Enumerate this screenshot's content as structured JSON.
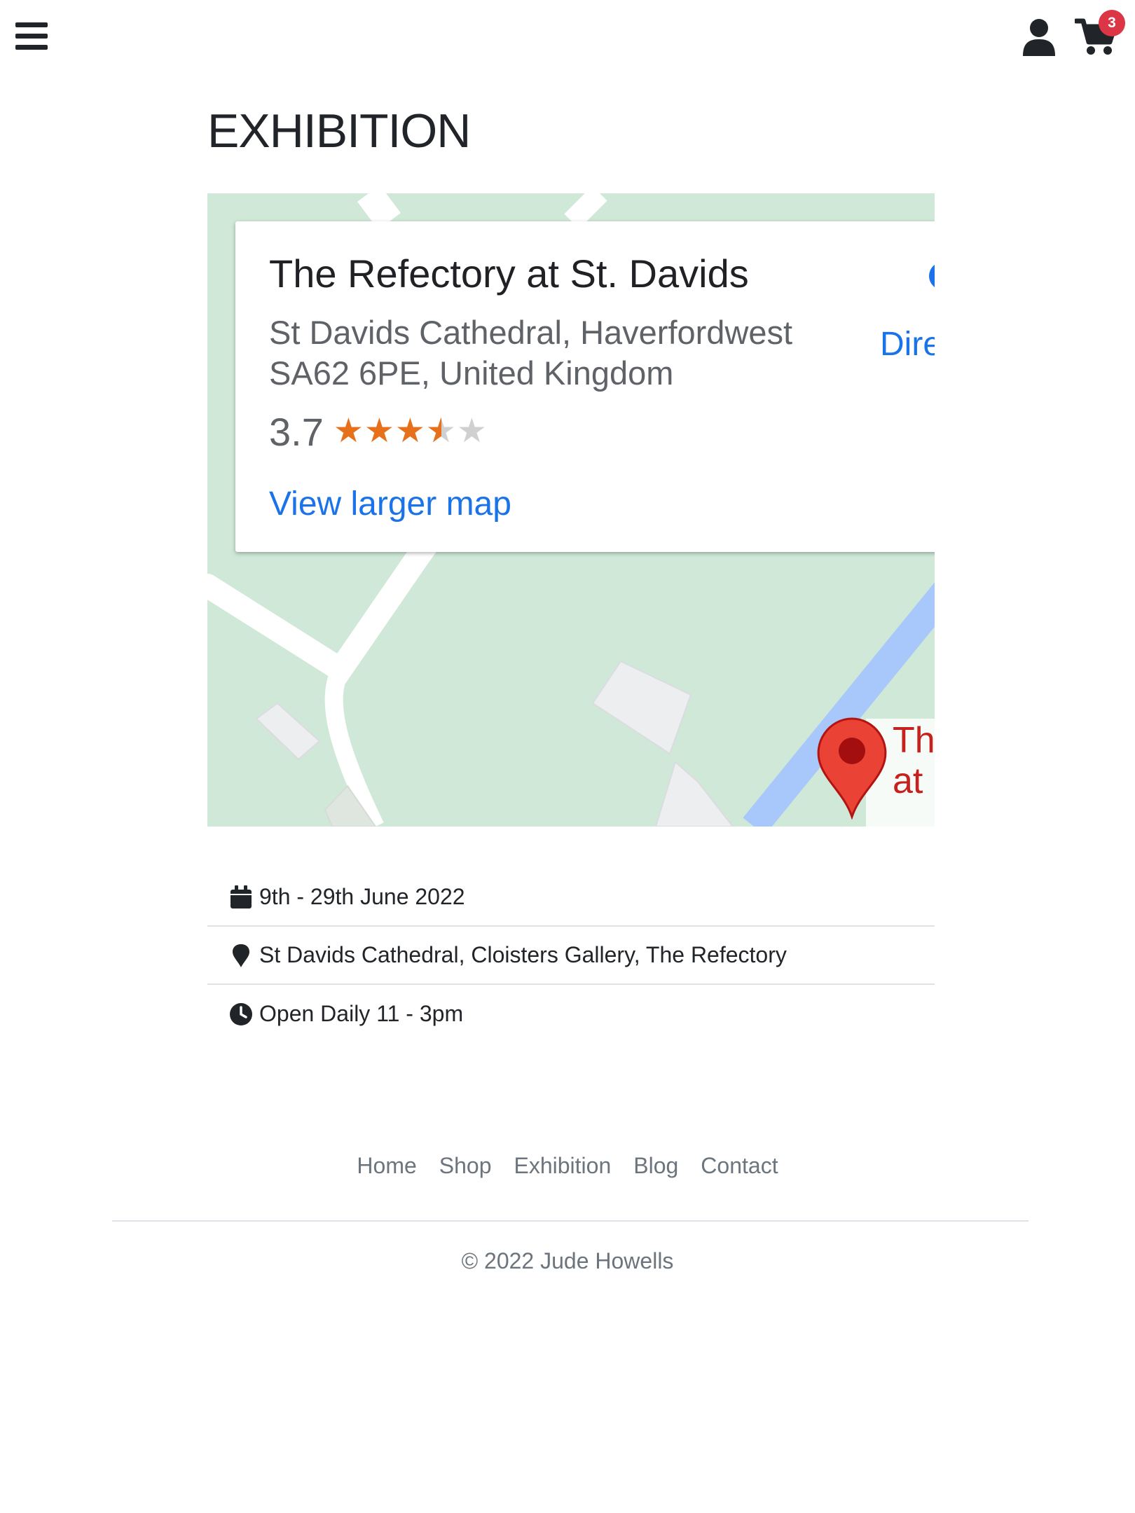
{
  "header": {
    "menu_icon": "hamburger-menu-icon",
    "user_icon": "user-icon",
    "cart_icon": "shopping-cart-icon",
    "cart_count": "3",
    "badge_color": "#dc3545"
  },
  "page": {
    "title": "EXHIBITION"
  },
  "map": {
    "place_name": "The Refectory at St. Davids",
    "address_line1": "St Davids Cathedral, Haverfordwest",
    "address_line2": "SA62 6PE, United Kingdom",
    "rating": "3.7",
    "stars_value": 3.7,
    "stars_max": 5,
    "larger_map_label": "View larger map",
    "directions_label": "Dire",
    "pin_label_line1": "Th",
    "pin_label_line2": "at",
    "link_color": "#1a73e8",
    "star_color": "#e7711b",
    "pin_color": "#ea4335"
  },
  "info": {
    "items": [
      {
        "icon": "calendar-icon",
        "text": "9th - 29th June 2022"
      },
      {
        "icon": "map-marker-icon",
        "text": "St Davids Cathedral, Cloisters Gallery, The Refectory"
      },
      {
        "icon": "clock-icon",
        "text": "Open Daily 11 - 3pm"
      }
    ]
  },
  "footer": {
    "nav": [
      {
        "label": "Home"
      },
      {
        "label": "Shop"
      },
      {
        "label": "Exhibition"
      },
      {
        "label": "Blog"
      },
      {
        "label": "Contact"
      }
    ],
    "copyright": "© 2022 Jude Howells"
  }
}
